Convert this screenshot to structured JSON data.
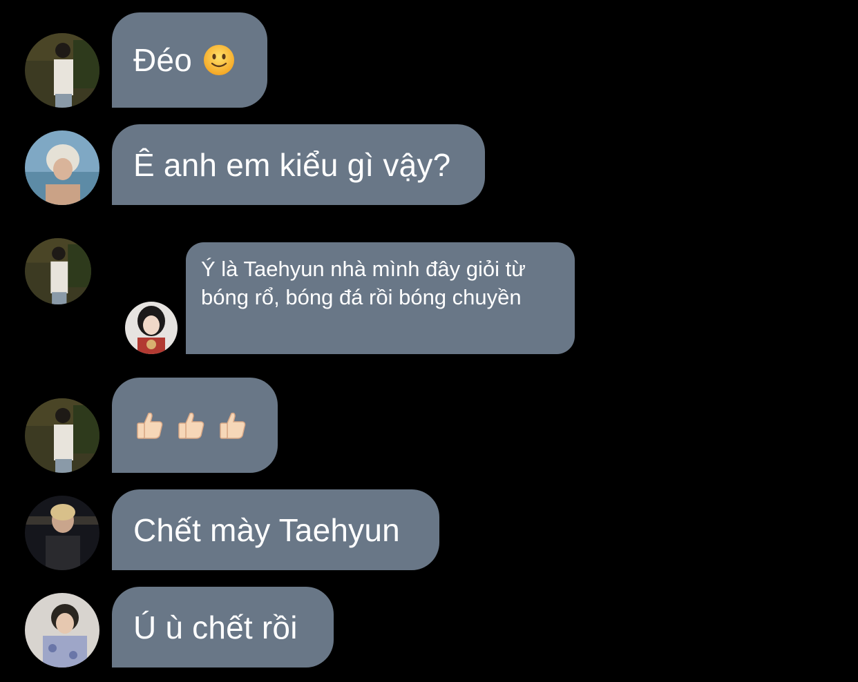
{
  "colors": {
    "background": "#000000",
    "bubble": "#697787",
    "text": "#ffffff"
  },
  "messages": [
    {
      "text": "Đéo",
      "emoji": "slightly-smiling-face-icon",
      "avatar": "avatar-user-1"
    },
    {
      "text": "Ê anh em kiểu gì vậy?",
      "avatar": "avatar-user-2"
    },
    {
      "text": "Ý là Taehyun nhà mình đây giỏi từ bóng rổ, bóng đá rồi bóng chuyền",
      "avatar": "avatar-user-1",
      "reply_avatar": "avatar-user-3"
    },
    {
      "text": "",
      "emoji": "thumbs-up-icon",
      "emoji_count": 3,
      "avatar": "avatar-user-1"
    },
    {
      "text": "Chết mày Taehyun",
      "avatar": "avatar-user-4"
    },
    {
      "text": "Ú ù chết rồi",
      "avatar": "avatar-user-5"
    }
  ]
}
